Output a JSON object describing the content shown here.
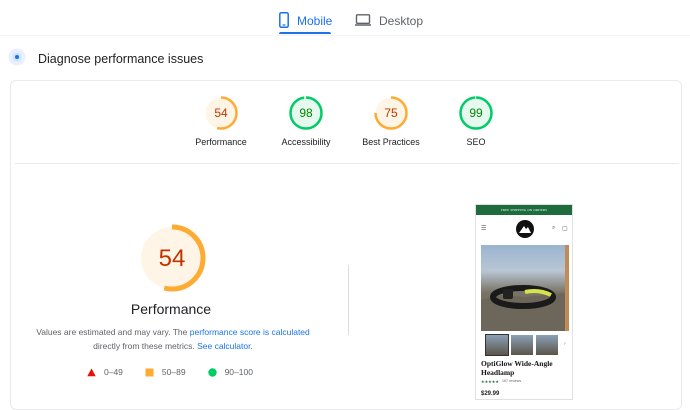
{
  "tabs": [
    {
      "label": "Mobile",
      "active": true,
      "icon": "mobile-phone-icon"
    },
    {
      "label": "Desktop",
      "active": false,
      "icon": "desktop-monitor-icon"
    }
  ],
  "diagnose": {
    "title": "Diagnose performance issues",
    "icon": "lighthouse-icon"
  },
  "colors": {
    "accent": "#1a73e8",
    "fail": "#eb0f00",
    "average": "#fa3",
    "pass": "#0c6",
    "average_text": "#c33300",
    "pass_text": "#008800"
  },
  "scores": [
    {
      "name": "Performance",
      "value": 54,
      "rating": "average"
    },
    {
      "name": "Accessibility",
      "value": 98,
      "rating": "pass"
    },
    {
      "name": "Best Practices",
      "value": 75,
      "rating": "average"
    },
    {
      "name": "SEO",
      "value": 99,
      "rating": "pass"
    }
  ],
  "detail": {
    "score": 54,
    "title": "Performance",
    "note_prefix": "Values are estimated and may vary. The ",
    "note_link1": "performance score is calculated",
    "note_mid": "directly from these metrics.",
    "note_link2": "See calculator."
  },
  "legend": [
    {
      "range": "0–49",
      "shape": "triangle",
      "rating": "fail"
    },
    {
      "range": "50–89",
      "shape": "square",
      "rating": "average"
    },
    {
      "range": "90–100",
      "shape": "circle",
      "rating": "pass"
    }
  ],
  "screenshot": {
    "promo": "FREE SHIPPING ON ORDERS",
    "product_title": "OptiGlow Wide-Angle Headlamp",
    "stars": "★★★★★",
    "reviews": "167 reviews",
    "price": "$29.99"
  }
}
